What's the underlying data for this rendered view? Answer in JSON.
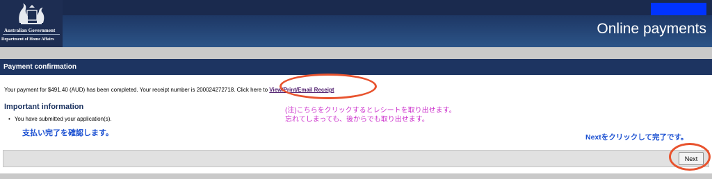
{
  "header": {
    "gov_name": "Australian Government",
    "department": "Department of Home Affairs",
    "title": "Online payments"
  },
  "section": {
    "title": "Payment confirmation"
  },
  "payment": {
    "message": "Your payment for $491.40 (AUD) has been completed. Your receipt number is 200024272718. Click here to ",
    "receipt_link": "View/Print/Email Receipt"
  },
  "important": {
    "heading": "Important information",
    "bullet": "You have submitted your application(s)."
  },
  "annotations": {
    "pink_line1": "(注)こちらをクリックするとレシートを取り出せます。",
    "pink_line2": "忘れてしまっても、後からでも取り出せます。",
    "blue_left": "支払い完了を確認します。",
    "blue_right": "Nextをクリックして完了です。"
  },
  "buttons": {
    "next": "Next"
  },
  "colors": {
    "header_navy": "#1d3461",
    "annotation_oval": "#e8532e",
    "annotation_pink": "#cc33cc",
    "annotation_blue": "#1a4fd1"
  }
}
